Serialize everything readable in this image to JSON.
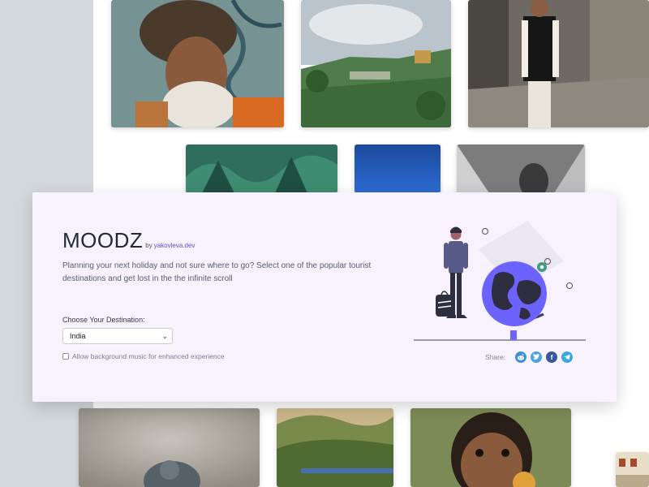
{
  "brand": {
    "title": "MOODZ",
    "by": "by",
    "author": "yakovleva.dev"
  },
  "description": "Planning your next holiday and not sure where to go? Select one of the popular tourist destinations and get lost in the the infinite scroll",
  "destination": {
    "label": "Choose Your Destination:",
    "selected": "India"
  },
  "music": {
    "label": "Allow background music for enhanced experience",
    "checked": false
  },
  "share": {
    "label": "Share:",
    "buttons": [
      {
        "name": "reddit",
        "icon": "reddit-icon",
        "color": "#3d8fd8"
      },
      {
        "name": "twitter",
        "icon": "twitter-icon",
        "color": "#4aa3df"
      },
      {
        "name": "facebook",
        "icon": "facebook-icon",
        "color": "#3b5998"
      },
      {
        "name": "telegram",
        "icon": "telegram-icon",
        "color": "#37a8da"
      }
    ]
  },
  "colors": {
    "accent": "#6c63ff",
    "card_bg": "#f7f2fd",
    "page_bg": "#d3d8dc"
  }
}
